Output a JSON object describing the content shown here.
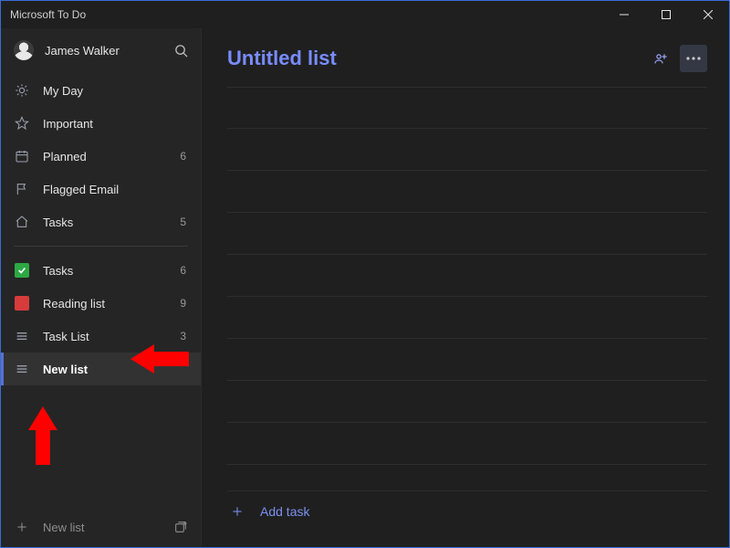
{
  "window": {
    "title": "Microsoft To Do"
  },
  "user": {
    "name": "James Walker"
  },
  "colors": {
    "accent": "#788cff"
  },
  "smartLists": [
    {
      "icon": "sun",
      "label": "My Day",
      "count": ""
    },
    {
      "icon": "star",
      "label": "Important",
      "count": ""
    },
    {
      "icon": "cal",
      "label": "Planned",
      "count": "6"
    },
    {
      "icon": "flag",
      "label": "Flagged Email",
      "count": ""
    },
    {
      "icon": "home",
      "label": "Tasks",
      "count": "5"
    }
  ],
  "userLists": [
    {
      "icon": "check",
      "label": "Tasks",
      "count": "6",
      "selected": false
    },
    {
      "icon": "red",
      "label": "Reading list",
      "count": "9",
      "selected": false
    },
    {
      "icon": "lines",
      "label": "Task List",
      "count": "3",
      "selected": false
    },
    {
      "icon": "lines",
      "label": "New list",
      "count": "",
      "selected": true
    }
  ],
  "newList": {
    "label": "New list"
  },
  "main": {
    "title": "Untitled list",
    "addTaskLabel": "Add task"
  }
}
